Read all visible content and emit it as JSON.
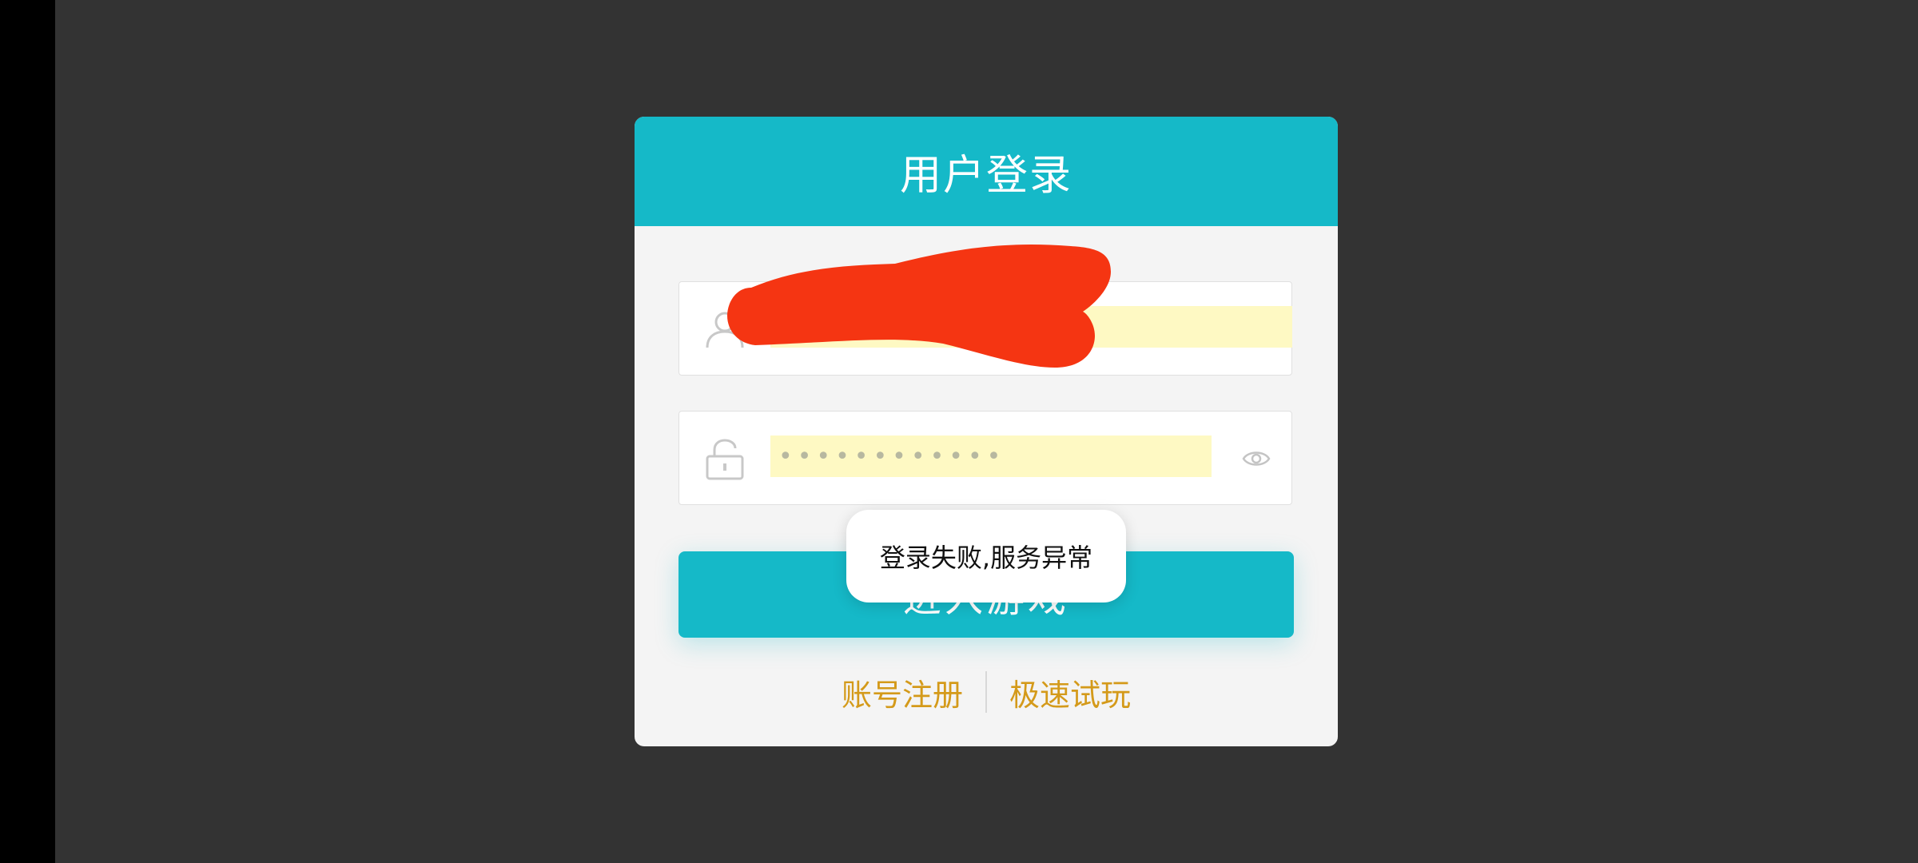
{
  "dialog": {
    "title": "用户登录",
    "username": {
      "value": "",
      "icon": "user-icon"
    },
    "password": {
      "masked_value": "••••••••••••",
      "icon": "unlock-icon",
      "toggle_icon": "eye-icon"
    },
    "login_button_label": "进入游戏",
    "links": {
      "register": "账号注册",
      "quick_play": "极速试玩"
    }
  },
  "toast": {
    "message": "登录失败,服务异常"
  },
  "colors": {
    "accent": "#15b9c8",
    "link": "#d49a1a",
    "autofill": "#fef9c3",
    "redaction": "#f53512",
    "backdrop": "#333333"
  }
}
